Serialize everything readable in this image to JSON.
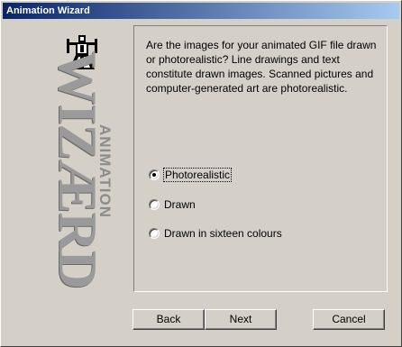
{
  "window": {
    "title": "Animation Wizard"
  },
  "branding": {
    "wizard_text": "WIZÆRD",
    "animation_text": "ANIMATION",
    "logo_icon": "wizard-figure-icon"
  },
  "question": "Are the images for your animated GIF file drawn or photorealistic? Line drawings and text constitute drawn images. Scanned pictures and computer-generated art are photorealistic.",
  "options": [
    {
      "label": "Photorealistic",
      "selected": true
    },
    {
      "label": "Drawn",
      "selected": false
    },
    {
      "label": "Drawn in sixteen colours",
      "selected": false
    }
  ],
  "buttons": {
    "back": "Back",
    "next": "Next",
    "cancel": "Cancel"
  }
}
